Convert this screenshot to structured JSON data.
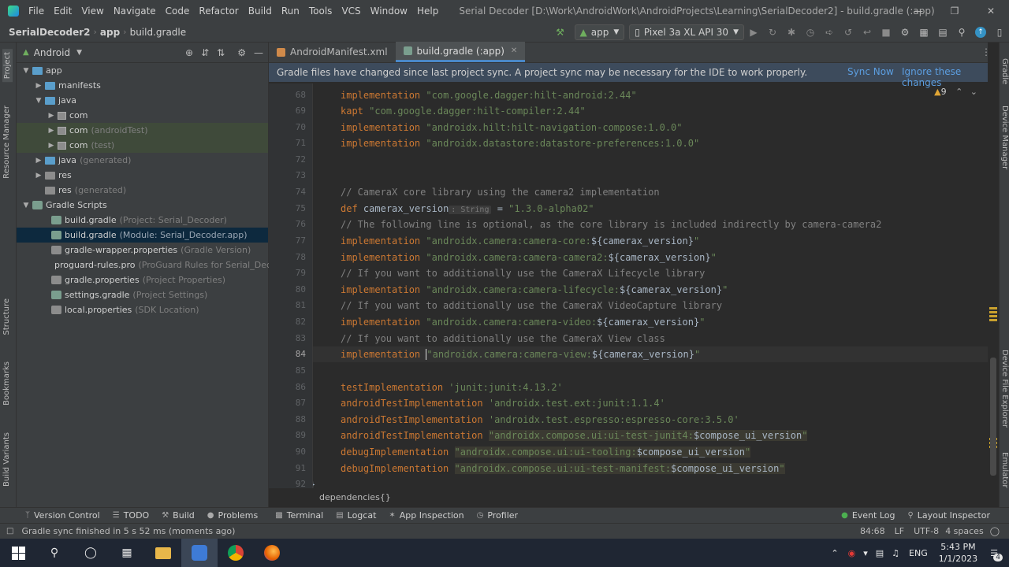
{
  "menubar": {
    "items": [
      "File",
      "Edit",
      "View",
      "Navigate",
      "Code",
      "Refactor",
      "Build",
      "Run",
      "Tools",
      "VCS",
      "Window",
      "Help"
    ],
    "title": "Serial Decoder [D:\\Work\\AndroidWork\\AndroidProjects\\Learning\\SerialDecoder2] - build.gradle (:app)"
  },
  "navbar": {
    "project": "SerialDecoder2",
    "module": "app",
    "file": "build.gradle",
    "run_config": "app",
    "device": "Pixel 3a XL API 30"
  },
  "left_strip": {
    "project": "Project",
    "resource_manager": "Resource Manager",
    "structure": "Structure",
    "bookmarks": "Bookmarks",
    "build_variants": "Build Variants"
  },
  "right_strip": {
    "gradle": "Gradle",
    "device_manager": "Device Manager",
    "device_file_explorer": "Device File Explorer",
    "emulator": "Emulator"
  },
  "project_panel": {
    "view": "Android",
    "tree": [
      {
        "label": "app",
        "hint": ""
      },
      {
        "label": "manifests",
        "hint": ""
      },
      {
        "label": "java",
        "hint": ""
      },
      {
        "label": "com",
        "hint": ""
      },
      {
        "label": "com",
        "hint": "(androidTest)"
      },
      {
        "label": "com",
        "hint": "(test)"
      },
      {
        "label": "java",
        "hint": "(generated)"
      },
      {
        "label": "res",
        "hint": ""
      },
      {
        "label": "res",
        "hint": "(generated)"
      },
      {
        "label": "Gradle Scripts",
        "hint": ""
      },
      {
        "label": "build.gradle",
        "hint": "(Project: Serial_Decoder)"
      },
      {
        "label": "build.gradle",
        "hint": "(Module: Serial_Decoder.app)"
      },
      {
        "label": "gradle-wrapper.properties",
        "hint": "(Gradle Version)"
      },
      {
        "label": "proguard-rules.pro",
        "hint": "(ProGuard Rules for Serial_Decode"
      },
      {
        "label": "gradle.properties",
        "hint": "(Project Properties)"
      },
      {
        "label": "settings.gradle",
        "hint": "(Project Settings)"
      },
      {
        "label": "local.properties",
        "hint": "(SDK Location)"
      }
    ]
  },
  "tabs": [
    {
      "label": "AndroidManifest.xml",
      "active": false
    },
    {
      "label": "build.gradle (:app)",
      "active": true
    }
  ],
  "banner": {
    "message": "Gradle files have changed since last project sync. A project sync may be necessary for the IDE to work properly.",
    "sync": "Sync Now",
    "ignore": "Ignore these changes"
  },
  "inspection": {
    "warnings": "9"
  },
  "code": {
    "line_numbers": [
      "68",
      "69",
      "70",
      "71",
      "72",
      "73",
      "74",
      "75",
      "76",
      "77",
      "78",
      "79",
      "80",
      "81",
      "82",
      "83",
      "84",
      "85",
      "86",
      "87",
      "88",
      "89",
      "90",
      "91",
      "92"
    ],
    "l68_kw": "implementation",
    "l68_str": "\"com.google.dagger:hilt-android:2.44\"",
    "l69_kw": "kapt",
    "l69_str": "\"com.google.dagger:hilt-compiler:2.44\"",
    "l70_kw": "implementation",
    "l70_str": "\"androidx.hilt:hilt-navigation-compose:1.0.0\"",
    "l71_kw": "implementation",
    "l71_str": "\"androidx.datastore:datastore-preferences:1.0.0\"",
    "l74": "// CameraX core library using the camera2 implementation",
    "l75_def": "def",
    "l75_name": "camerax_version",
    "l75_hint": ": String",
    "l75_eq": " = ",
    "l75_str": "\"1.3.0-alpha02\"",
    "l76": "// The following line is optional, as the core library is included indirectly by camera-camera2",
    "l77_kw": "implementation",
    "l77_str": "\"androidx.camera:camera-core:",
    "l77_var": "${camerax_version}",
    "l77_end": "\"",
    "l78_kw": "implementation",
    "l78_str": "\"androidx.camera:camera-camera2:",
    "l78_var": "${camerax_version}",
    "l78_end": "\"",
    "l79": "// If you want to additionally use the CameraX Lifecycle library",
    "l80_kw": "implementation",
    "l80_str": "\"androidx.camera:camera-lifecycle:",
    "l80_var": "${camerax_version}",
    "l80_end": "\"",
    "l81": "// If you want to additionally use the CameraX VideoCapture library",
    "l82_kw": "implementation",
    "l82_str": "\"androidx.camera:camera-video:",
    "l82_var": "${camerax_version}",
    "l82_end": "\"",
    "l83": "// If you want to additionally use the CameraX View class",
    "l84_kw": "implementation",
    "l84_str": "\"androidx.camera:camera-view:",
    "l84_var": "${camerax_version}",
    "l84_end": "\"",
    "l86_kw": "testImplementation",
    "l86_str": "'junit:junit:4.13.2'",
    "l87_kw": "androidTestImplementation",
    "l87_str": "'androidx.test.ext:junit:1.1.4'",
    "l88_kw": "androidTestImplementation",
    "l88_str": "'androidx.test.espresso:espresso-core:3.5.0'",
    "l89_kw": "androidTestImplementation",
    "l89_str": "\"androidx.compose.ui:ui-test-junit4:",
    "l89_var": "$compose_ui_version",
    "l89_end": "\"",
    "l90_kw": "debugImplementation",
    "l90_str": "\"androidx.compose.ui:ui-tooling:",
    "l90_var": "$compose_ui_version",
    "l90_end": "\"",
    "l91_kw": "debugImplementation",
    "l91_str": "\"androidx.compose.ui:ui-test-manifest:",
    "l91_var": "$compose_ui_version",
    "l91_end": "\"",
    "l92": "}"
  },
  "breadcrumb": "dependencies{}",
  "bottom_tools": {
    "version_control": "Version Control",
    "todo": "TODO",
    "build": "Build",
    "problems": "Problems",
    "terminal": "Terminal",
    "logcat": "Logcat",
    "app_inspection": "App Inspection",
    "profiler": "Profiler",
    "event_log": "Event Log",
    "layout_inspector": "Layout Inspector"
  },
  "status": {
    "message": "Gradle sync finished in 5 s 52 ms (moments ago)",
    "position": "84:68",
    "line_sep": "LF",
    "encoding": "UTF-8",
    "indent": "4 spaces"
  },
  "taskbar": {
    "lang": "ENG",
    "time": "5:43 PM",
    "date": "1/1/2023",
    "notif": "4"
  },
  "colors": {
    "keyword": "#cc7832",
    "string": "#6a8759",
    "comment": "#808080",
    "link": "#5c9ee0",
    "selection": "#0d293e"
  }
}
